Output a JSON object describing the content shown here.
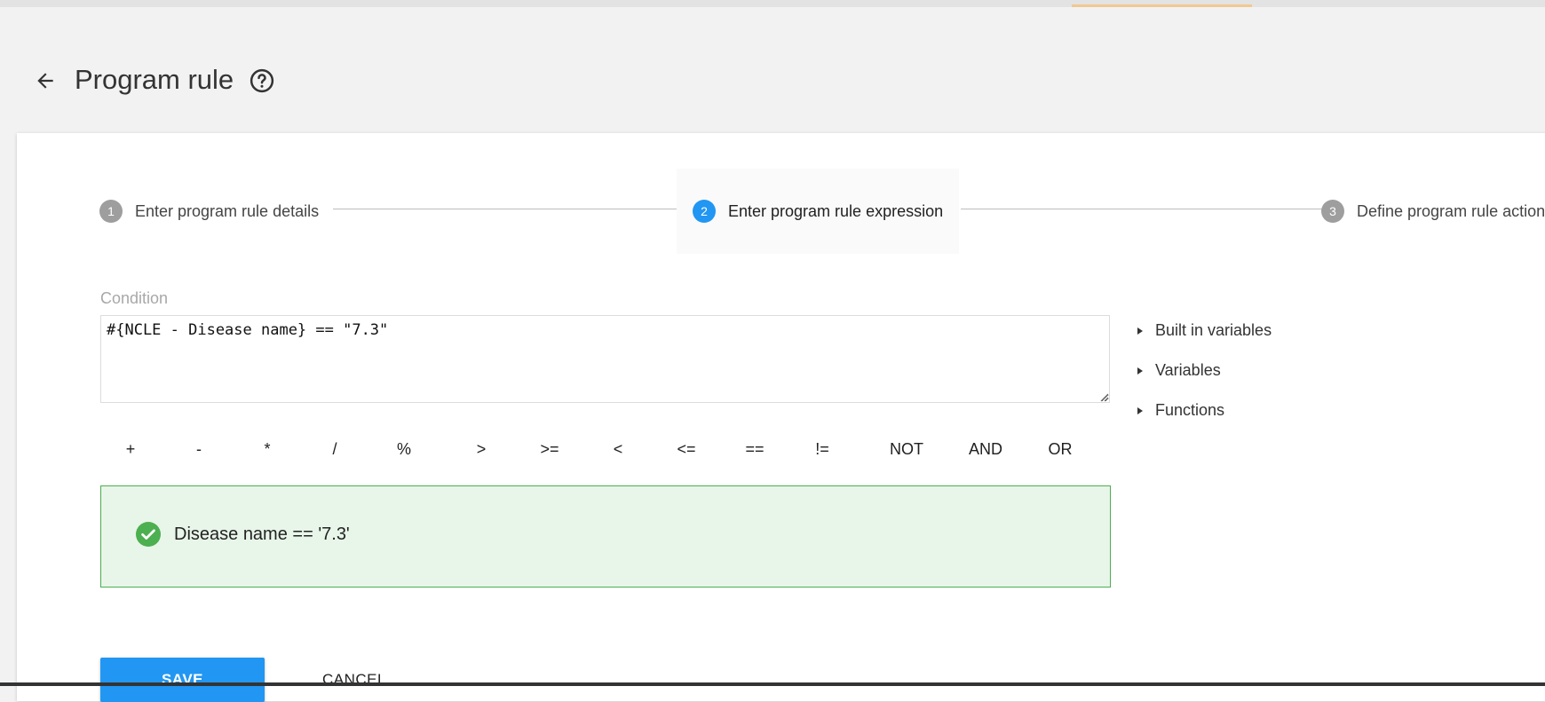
{
  "header": {
    "title": "Program rule"
  },
  "stepper": {
    "steps": [
      {
        "number": "1",
        "label": "Enter program rule details"
      },
      {
        "number": "2",
        "label": "Enter program rule expression"
      },
      {
        "number": "3",
        "label": "Define program rule actions"
      }
    ],
    "active_step": 2
  },
  "condition": {
    "label": "Condition",
    "value": "#{NCLE - Disease name} == \"7.3\""
  },
  "variable_menu": {
    "items": [
      "Built in variables",
      "Variables",
      "Functions"
    ]
  },
  "operators": [
    "+",
    "-",
    "*",
    "/",
    "%",
    ">",
    ">=",
    "<",
    "<=",
    "==",
    "!=",
    "NOT",
    "AND",
    "OR"
  ],
  "result": {
    "text": "Disease name == '7.3'",
    "status": "valid"
  },
  "actions": {
    "save_label": "SAVE",
    "cancel_label": "CANCEL"
  },
  "colors": {
    "accent": "#2196f3",
    "success": "#4caf50",
    "success_bg": "#e8f5e9"
  }
}
